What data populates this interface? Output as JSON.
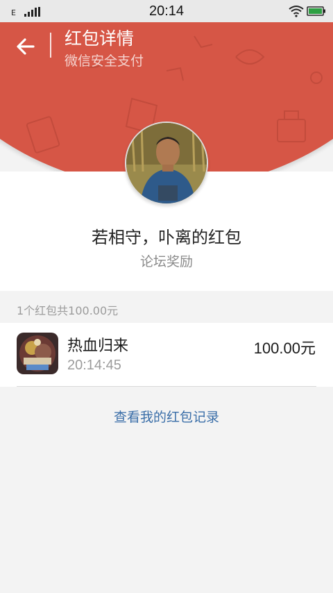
{
  "status_bar": {
    "network": "E",
    "time": "20:14"
  },
  "header": {
    "title": "红包详情",
    "subtitle": "微信安全支付",
    "accent_color": "#d65646"
  },
  "sender": {
    "name": "若相守，卟离的红包",
    "greeting": "论坛奖励"
  },
  "summary": "1个红包共100.00元",
  "records": [
    {
      "name": "热血归来",
      "time": "20:14:45",
      "amount": "100.00元"
    }
  ],
  "footer": {
    "history_link": "查看我的红包记录",
    "link_color": "#3a6ea8"
  }
}
